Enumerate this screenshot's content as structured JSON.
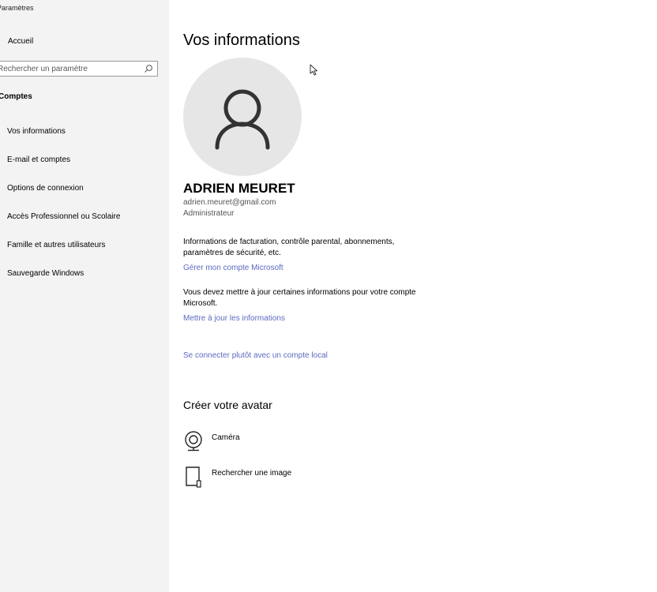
{
  "sidebar": {
    "app_title": "Paramètres",
    "home_label": "Accueil",
    "search_placeholder": "Rechercher un paramètre",
    "section_label": "Comptes",
    "items": [
      {
        "label": "Vos informations"
      },
      {
        "label": "E-mail et comptes"
      },
      {
        "label": "Options de connexion"
      },
      {
        "label": "Accès Professionnel ou Scolaire"
      },
      {
        "label": "Famille et autres utilisateurs"
      },
      {
        "label": "Sauvegarde Windows"
      }
    ]
  },
  "main": {
    "title": "Vos informations",
    "user": {
      "name": "ADRIEN MEURET",
      "email": "adrien.meuret@gmail.com",
      "role": "Administrateur"
    },
    "billing_info": "Informations de facturation, contrôle parental, abonnements, paramètres de sécurité, etc.",
    "manage_link": "Gérer mon compte Microsoft",
    "update_info": "Vous devez mettre à jour certaines informations pour votre compte Microsoft.",
    "update_link": "Mettre à jour les informations",
    "local_link": "Se connecter plutôt avec un compte local",
    "avatar_title": "Créer votre avatar",
    "avatar_options": [
      {
        "label": "Caméra",
        "icon": "camera-icon"
      },
      {
        "label": "Rechercher une image",
        "icon": "browse-image-icon"
      }
    ]
  },
  "colors": {
    "sidebar_bg": "#f3f3f3",
    "link": "#5c6bc0",
    "avatar_bg": "#e6e6e6",
    "avatar_glyph": "#333333"
  }
}
